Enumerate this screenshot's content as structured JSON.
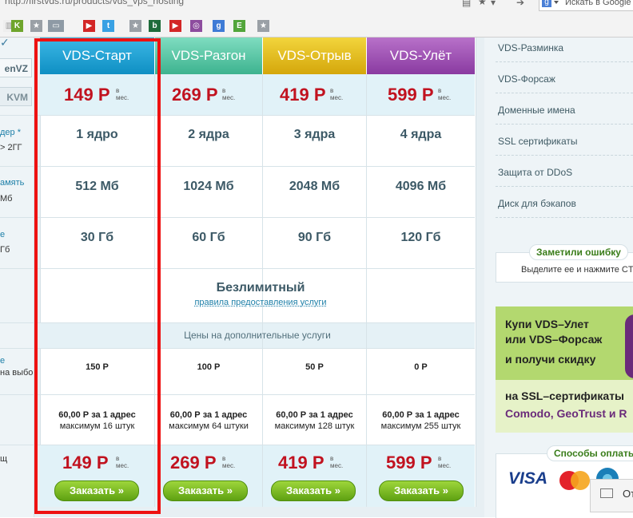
{
  "browser": {
    "url": "http://firstvds.ru/products/vds_vps_hosting",
    "search_placeholder": "Искать в Google"
  },
  "left_cut": {
    "tab_openvz": "enVZ",
    "tab_kvm": "KVM",
    "cpu_label": "дер *",
    "cpu_sub": "> 2ГГ",
    "ram_label": "амять",
    "ram_sub": "Мб",
    "disk_label": "е",
    "disk_sub": "Гб",
    "extra_label": "е",
    "extra_sub": "на выбо",
    "total_label": "щ"
  },
  "plans": [
    {
      "name": "VDS-Старт",
      "color": "#1aa3d6",
      "price": "149 Р",
      "cpu": "1 ядро",
      "ram": "512 Мб",
      "disk": "30 Гб",
      "extra_price": "150 Р",
      "ip_line1": "60,00 Р за 1 адрес",
      "ip_line2": "максимум 16 штук"
    },
    {
      "name": "VDS-Разгон",
      "color": "#5cc8a8",
      "price": "269 Р",
      "cpu": "2 ядра",
      "ram": "1024 Мб",
      "disk": "60 Гб",
      "extra_price": "100 Р",
      "ip_line1": "60,00 Р за 1 адрес",
      "ip_line2": "максимум 64 штуки"
    },
    {
      "name": "VDS-Отрыв",
      "color": "#e6c21a",
      "price": "419 Р",
      "cpu": "3 ядра",
      "ram": "2048 Мб",
      "disk": "90 Гб",
      "extra_price": "50 Р",
      "ip_line1": "60,00 Р за 1 адрес",
      "ip_line2": "максимум 128 штук"
    },
    {
      "name": "VDS-Улёт",
      "color": "#a04fb6",
      "price": "599 Р",
      "cpu": "4 ядра",
      "ram": "4096 Мб",
      "disk": "120 Гб",
      "extra_price": "0 Р",
      "ip_line1": "60,00 Р за 1 адрес",
      "ip_line2": "максимум 255 штук"
    }
  ],
  "price_suffix_top": "в",
  "price_suffix_bottom": "мес.",
  "traffic": {
    "value": "Безлимитный",
    "link": "правила предоставления услуги"
  },
  "extras_header": "Цены на дополнительные услуги",
  "order_label": "Заказать »",
  "sidebar": {
    "menu": [
      "VDS-Разминка",
      "VDS-Форсаж",
      "Доменные имена",
      "SSL сертификаты",
      "Защита от DDoS",
      "Диск для бэкапов"
    ],
    "error_title": "Заметили ошибку",
    "error_text": "Выделите ее и нажмите CT",
    "banner_line1": "Купи VDS–Улет",
    "banner_line2": "или VDS–Форсаж",
    "banner_line3": "и получи скидку",
    "banner_line4": "на SSL–сертификаты",
    "banner_line5": "Comodo, GeoTrust и R",
    "payment_title": "Способы оплаты",
    "payment_visa": "VISA",
    "chat_label": "От"
  }
}
